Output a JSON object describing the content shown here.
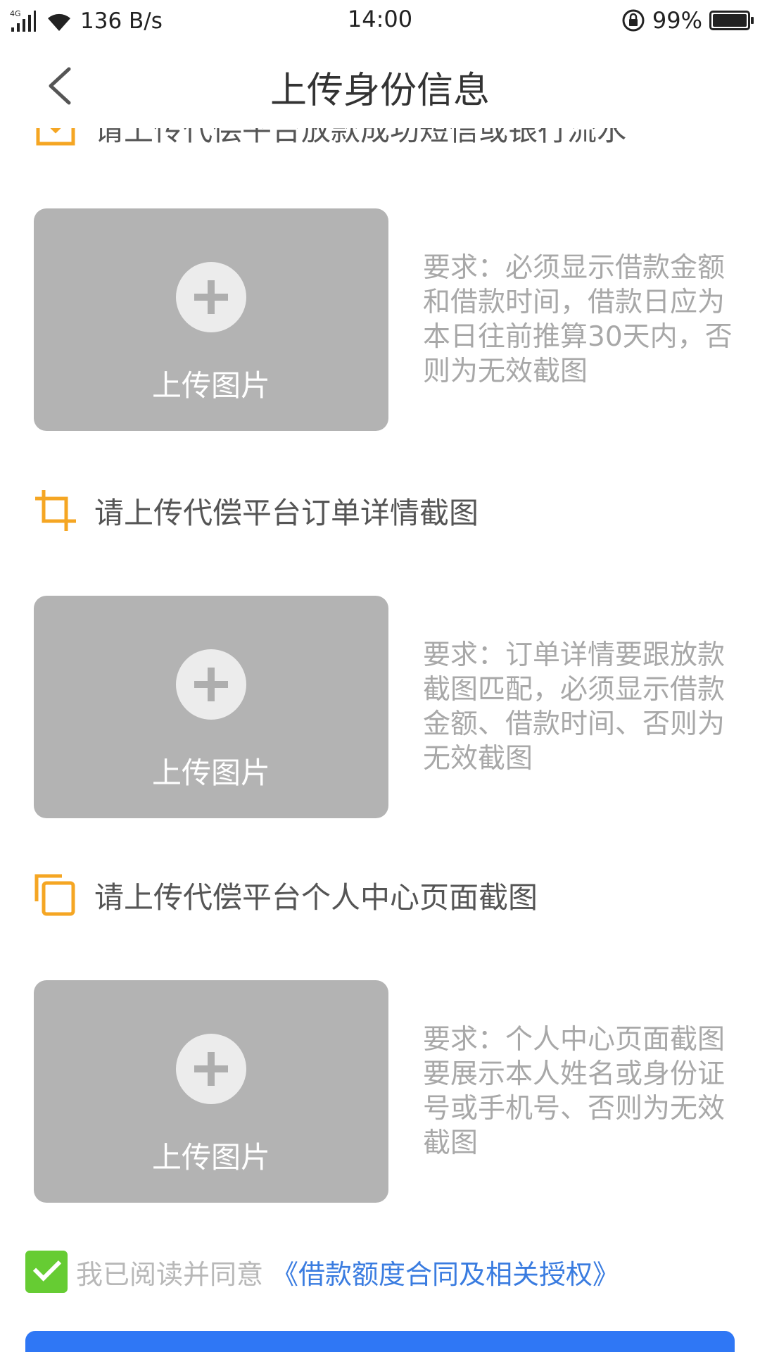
{
  "status_bar": {
    "network": "4G",
    "net_speed": "136 B/s",
    "time": "14:00",
    "battery_level": "99%",
    "battery_fraction": 0.99
  },
  "header": {
    "title": "上传身份信息"
  },
  "sections": [
    {
      "title": "请上传代偿平台放款成功短信或银行流水",
      "icon": "upload-tray-icon",
      "upload_label": "上传图片",
      "requirement": "要求：必须显示借款金额和借款时间，借款日应为本日往前推算30天内，否则为无效截图"
    },
    {
      "title": "请上传代偿平台订单详情截图",
      "icon": "crop-icon",
      "upload_label": "上传图片",
      "requirement": "要求：订单详情要跟放款截图匹配，必须显示借款金额、借款时间、否则为无效截图"
    },
    {
      "title": "请上传代偿平台个人中心页面截图",
      "icon": "copy-icon",
      "upload_label": "上传图片",
      "requirement": "要求：个人中心页面截图要展示本人姓名或身份证号或手机号、否则为无效截图"
    }
  ],
  "agreement": {
    "text": "我已阅读并同意",
    "link": "《借款额度合同及相关授权》",
    "checked": true
  },
  "colors": {
    "accent_orange": "#f5a623",
    "link_blue": "#3a7ce0",
    "check_green": "#66cc33",
    "button_blue": "#2f77f5"
  }
}
